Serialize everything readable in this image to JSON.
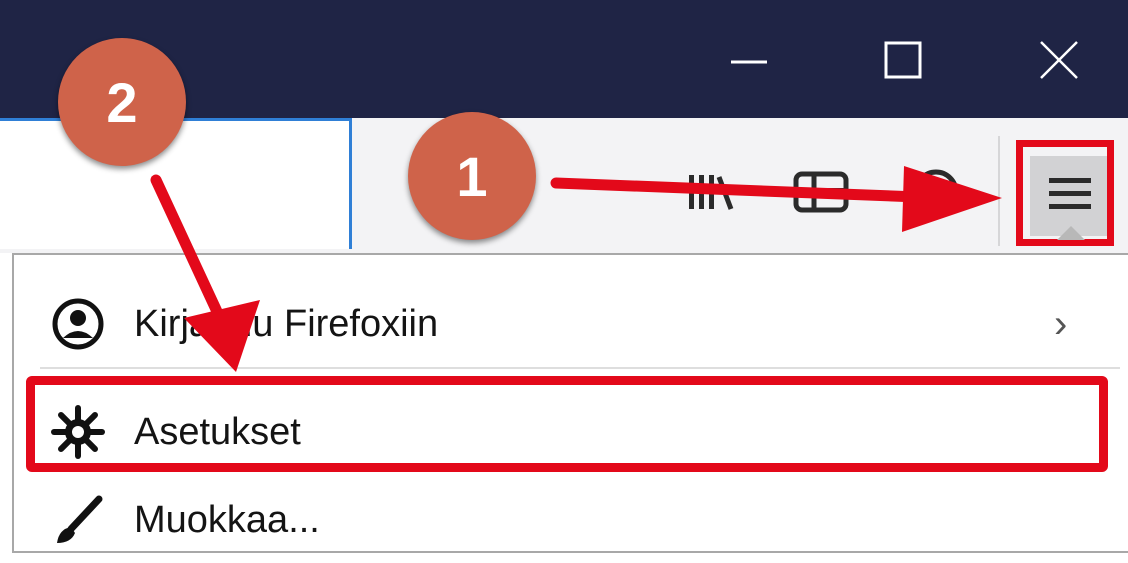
{
  "window_controls": {
    "minimize_icon": "minimize-icon",
    "maximize_icon": "maximize-icon",
    "close_icon": "close-icon"
  },
  "toolbar": {
    "library_icon": "library-icon",
    "sidebar_icon": "sidebar-icon",
    "account_icon": "account-icon",
    "menu_icon": "hamburger-menu-icon"
  },
  "menu": {
    "items": [
      {
        "label": "Kirjaudu Firefoxiin",
        "icon": "account-circle-icon",
        "chevron": "›"
      },
      {
        "label": "Asetukset",
        "icon": "gear-icon"
      },
      {
        "label": "Muokkaa...",
        "icon": "paintbrush-icon"
      }
    ]
  },
  "annotations": {
    "callout_1": "1",
    "callout_2": "2",
    "highlight_color": "#e3091a",
    "callout_color": "#cf634a"
  },
  "colors": {
    "titlebar": "#1f2445",
    "toolbar": "#f3f3f5",
    "urlbar_focus": "#2f7fd6"
  }
}
